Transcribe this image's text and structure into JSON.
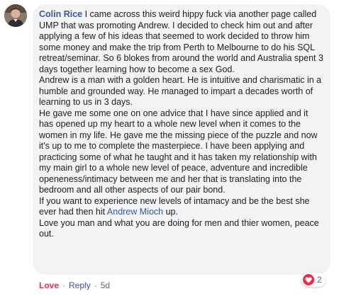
{
  "comment": {
    "author": "Colin Rice",
    "paragraphs": [
      "I came across this weird hippy fuck via another page called UMP that was promoting Andrew. I decided to check him out and after applying a few of his ideas that seemed to work decided to throw him some money and make the trip from Perth to Melbourne to do his SQL retreat/seminar. So 6 blokes from around the world and Australia spent 3 days together learning how to become a sex God.",
      "Andrew is a man with a golden heart. He is intuitive and charismatic in a humble and grounded way. He managed to impart a decades worth of learning to us in 3 days.",
      "He gave me some one on one advice that I have since applied and it has opened up my heart to a whole new level when it comes to the women in my life. He gave me the missing piece of the puzzle and now it's up to me to complete the masterpiece. I have been applying and practicing some of what he taught and it has taken my relationship with my main girl to a whole new level of peace, adventure and incredible openeness/intimacy between me and her that is translating into the bedroom and all other aspects of our pair bond."
    ],
    "tagged_paragraph": {
      "before": "If you want to experience new levels of intamacy and be the best she ever had then hit ",
      "mention": "Andrew Mioch",
      "after": " up."
    },
    "closing": "Love you man and what you are doing for men and thier women, peace out."
  },
  "actions": {
    "love_label": "Love",
    "reply_label": "Reply",
    "separator": "·",
    "time": "5d"
  },
  "reactions": {
    "icon": "heart-icon",
    "count": "2",
    "color": "#f0284a"
  },
  "colors": {
    "bubble_bg": "#f2f3f5",
    "link": "#385898",
    "text": "#1c1e21",
    "meta": "#606770"
  }
}
